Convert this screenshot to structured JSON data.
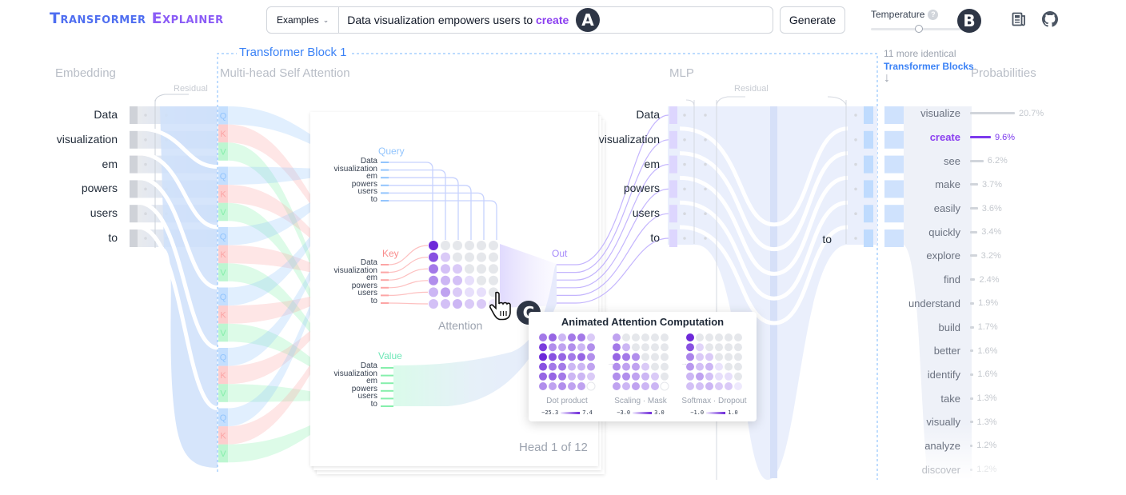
{
  "header": {
    "logo_part1": "Transformer",
    "logo_part2": "Explainer",
    "examples_label": "Examples",
    "prompt_text": "Data visualization empowers users to",
    "predicted_token": "create",
    "generate_label": "Generate",
    "temperature_label": "Temperature",
    "temperature_value": 0.5,
    "help_glyph": "?",
    "icons": [
      "article-icon",
      "github-icon"
    ]
  },
  "annotations": {
    "a": "A",
    "b": "B",
    "c": "C"
  },
  "sections": {
    "embedding": "Embedding",
    "attention": "Multi-head Self Attention",
    "mlp": "MLP",
    "probabilities": "Probabilities",
    "residual": "Residual",
    "block_title": "Transformer Block 1",
    "more_blocks_prefix": "11 more identical",
    "more_blocks_strong": "Transformer Blocks",
    "more_blocks_suffix": "."
  },
  "tokens": [
    "Data",
    "visualization",
    "em",
    "powers",
    "users",
    "to"
  ],
  "qkv_letters": [
    "Q",
    "K",
    "V"
  ],
  "attention_head": {
    "query_label": "Query",
    "key_label": "Key",
    "value_label": "Value",
    "out_label": "Out",
    "attention_label": "Attention",
    "head_label": "Head 1 of 12",
    "attention_matrix": [
      [
        1.0,
        0,
        0,
        0,
        0,
        0
      ],
      [
        0.8,
        0.2,
        0,
        0,
        0,
        0
      ],
      [
        0.6,
        0.25,
        0.2,
        0,
        0,
        0
      ],
      [
        0.5,
        0.3,
        0.25,
        0.1,
        0,
        0
      ],
      [
        0.3,
        0.4,
        0.2,
        0.1,
        0.1,
        0
      ],
      [
        0.25,
        0.25,
        0.3,
        0.2,
        0.2,
        0.05
      ]
    ]
  },
  "popup": {
    "title": "Animated Attention Computation",
    "stages": [
      {
        "caption": "Dot product",
        "min": "−25.3",
        "max": "7.4",
        "matrix": [
          [
            0.6,
            0.7,
            0.3,
            0.6,
            0.6,
            0.2
          ],
          [
            0.9,
            0.5,
            0.4,
            0.5,
            0.3,
            0.5
          ],
          [
            1.0,
            0.8,
            0.7,
            0.6,
            0.7,
            0.5
          ],
          [
            0.8,
            0.6,
            0.6,
            0.3,
            0.3,
            0.4
          ],
          [
            0.7,
            0.7,
            0.6,
            0.3,
            0.3,
            0.2
          ],
          [
            0.5,
            0.4,
            0.5,
            0.4,
            0.4,
            0.0
          ]
        ]
      },
      {
        "caption": "Scaling · Mask",
        "min": "−3.0",
        "max": "3.0",
        "matrix": [
          [
            0.4,
            -1,
            -1,
            -1,
            -1,
            -1
          ],
          [
            0.6,
            0.3,
            -1,
            -1,
            -1,
            -1
          ],
          [
            0.7,
            0.6,
            0.5,
            -1,
            -1,
            -1
          ],
          [
            0.5,
            0.4,
            0.4,
            0.2,
            -1,
            -1
          ],
          [
            0.5,
            0.5,
            0.4,
            0.3,
            0.2,
            -1
          ],
          [
            0.4,
            0.3,
            0.4,
            0.3,
            0.3,
            0.0
          ]
        ]
      },
      {
        "caption": "Softmax · Dropout",
        "min": "−1.0",
        "max": "1.0",
        "matrix": [
          [
            1.0,
            -1,
            -1,
            -1,
            -1,
            -1
          ],
          [
            0.8,
            0.15,
            -1,
            -1,
            -1,
            -1
          ],
          [
            0.55,
            0.2,
            0.2,
            -1,
            -1,
            -1
          ],
          [
            0.45,
            0.25,
            0.3,
            0.08,
            -1,
            -1
          ],
          [
            0.3,
            0.4,
            0.25,
            0.1,
            0.1,
            -1
          ],
          [
            0.25,
            0.25,
            0.3,
            0.2,
            0.2,
            0.05
          ]
        ]
      }
    ]
  },
  "mlp_last_token": "to",
  "probabilities": [
    {
      "word": "visualize",
      "pct": 20.7,
      "label": "20.7%"
    },
    {
      "word": "create",
      "pct": 9.6,
      "label": "9.6%",
      "selected": true
    },
    {
      "word": "see",
      "pct": 6.2,
      "label": "6.2%"
    },
    {
      "word": "make",
      "pct": 3.7,
      "label": "3.7%"
    },
    {
      "word": "easily",
      "pct": 3.6,
      "label": "3.6%"
    },
    {
      "word": "quickly",
      "pct": 3.4,
      "label": "3.4%"
    },
    {
      "word": "explore",
      "pct": 3.2,
      "label": "3.2%"
    },
    {
      "word": "find",
      "pct": 2.4,
      "label": "2.4%"
    },
    {
      "word": "understand",
      "pct": 1.9,
      "label": "1.9%"
    },
    {
      "word": "build",
      "pct": 1.7,
      "label": "1.7%"
    },
    {
      "word": "better",
      "pct": 1.6,
      "label": "1.6%"
    },
    {
      "word": "identify",
      "pct": 1.6,
      "label": "1.6%"
    },
    {
      "word": "take",
      "pct": 1.3,
      "label": "1.3%"
    },
    {
      "word": "visually",
      "pct": 1.3,
      "label": "1.3%"
    },
    {
      "word": "analyze",
      "pct": 1.2,
      "label": "1.2%"
    },
    {
      "word": "discover",
      "pct": 1.2,
      "label": "1.2%"
    }
  ],
  "colors": {
    "query": "#93c5fd",
    "key": "#fca5a5",
    "value": "#86efac",
    "accent": "#7c3aed",
    "block": "#3b82f6"
  }
}
